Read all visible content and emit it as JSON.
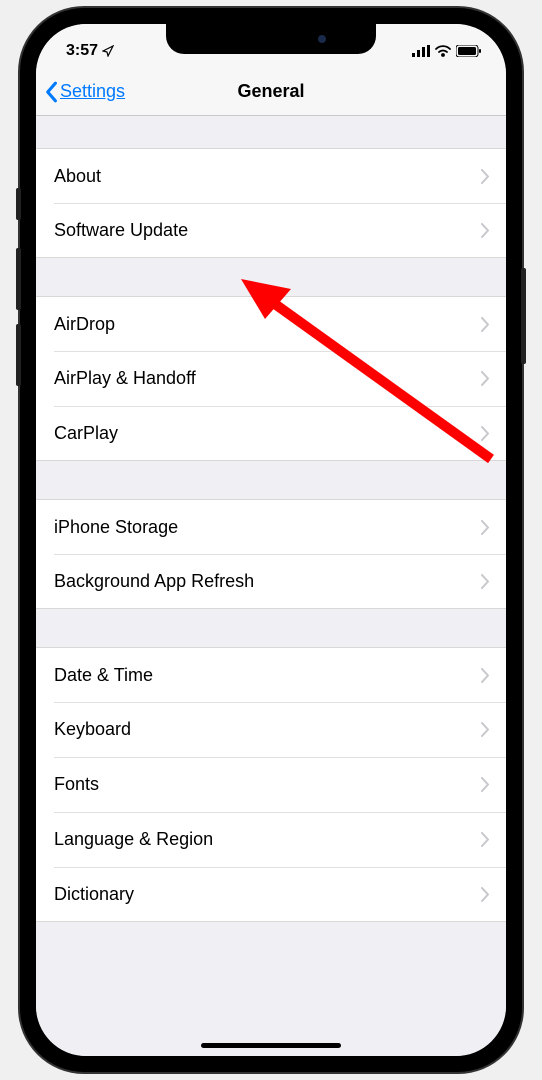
{
  "status": {
    "time": "3:57",
    "location_icon": "↗"
  },
  "nav": {
    "back_label": "Settings",
    "title": "General"
  },
  "groups": [
    {
      "items": [
        {
          "id": "about",
          "label": "About"
        },
        {
          "id": "software-update",
          "label": "Software Update"
        }
      ]
    },
    {
      "items": [
        {
          "id": "airdrop",
          "label": "AirDrop"
        },
        {
          "id": "airplay-handoff",
          "label": "AirPlay & Handoff"
        },
        {
          "id": "carplay",
          "label": "CarPlay"
        }
      ]
    },
    {
      "items": [
        {
          "id": "iphone-storage",
          "label": "iPhone Storage"
        },
        {
          "id": "background-app-refresh",
          "label": "Background App Refresh"
        }
      ]
    },
    {
      "items": [
        {
          "id": "date-time",
          "label": "Date & Time"
        },
        {
          "id": "keyboard",
          "label": "Keyboard"
        },
        {
          "id": "fonts",
          "label": "Fonts"
        },
        {
          "id": "language-region",
          "label": "Language & Region"
        },
        {
          "id": "dictionary",
          "label": "Dictionary"
        }
      ]
    }
  ],
  "annotation": {
    "color": "#ff0000",
    "target": "software-update"
  }
}
